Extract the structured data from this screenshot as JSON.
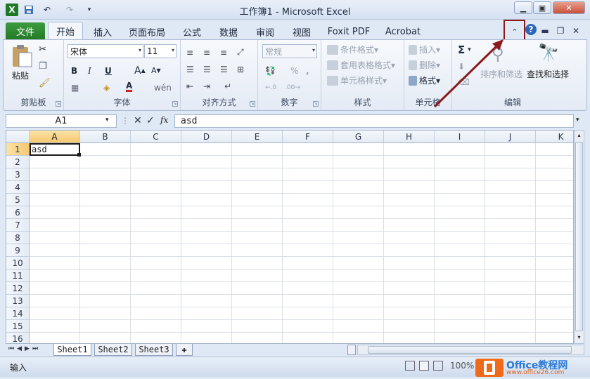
{
  "window": {
    "title": "工作簿1 - Microsoft Excel"
  },
  "qat": {
    "app_icon": "excel-logo-icon",
    "save_icon": "save-icon",
    "undo_icon": "undo-icon",
    "redo_icon": "redo-icon",
    "customize_icon": "customize-qat-icon"
  },
  "tabs": [
    {
      "label": "文件"
    },
    {
      "label": "开始"
    },
    {
      "label": "插入"
    },
    {
      "label": "页面布局"
    },
    {
      "label": "公式"
    },
    {
      "label": "数据"
    },
    {
      "label": "审阅"
    },
    {
      "label": "视图"
    },
    {
      "label": "Foxit PDF"
    },
    {
      "label": "Acrobat"
    }
  ],
  "ribbon": {
    "clipboard": {
      "paste": "粘贴",
      "label": "剪贴板"
    },
    "font": {
      "name": "宋体",
      "size": "11",
      "label": "字体",
      "bold": "B",
      "italic": "I",
      "underline": "U"
    },
    "alignment": {
      "label": "对齐方式"
    },
    "number": {
      "format": "常规",
      "percent": "%",
      "comma": ",",
      "label": "数字"
    },
    "styles": {
      "conditional": "条件格式",
      "table": "套用表格格式",
      "cell": "单元格样式",
      "label": "样式"
    },
    "cells": {
      "insert": "插入",
      "delete": "删除",
      "format": "格式",
      "label": "单元格"
    },
    "editing": {
      "sigma": "Σ",
      "sort": "排序和筛选",
      "find": "查找和选择",
      "label": "编辑"
    }
  },
  "formula_bar": {
    "name_box": "A1",
    "fx": "fx",
    "value": "asd"
  },
  "grid": {
    "columns": [
      "A",
      "B",
      "C",
      "D",
      "E",
      "F",
      "G",
      "H",
      "I",
      "J",
      "K"
    ],
    "rows": [
      "1",
      "2",
      "3",
      "4",
      "5",
      "6",
      "7",
      "8",
      "9",
      "10",
      "11",
      "12",
      "13",
      "14",
      "15",
      "16"
    ],
    "a1_value": "asd"
  },
  "sheets": [
    {
      "label": "Sheet1"
    },
    {
      "label": "Sheet2"
    },
    {
      "label": "Sheet3"
    }
  ],
  "status": {
    "mode": "输入",
    "zoom": "100%"
  },
  "watermark": {
    "brand": "Office教程网",
    "url": "www.office26.com"
  },
  "colors": {
    "file_tab": "#2f8a31",
    "callout": "#8b1a1a",
    "selection": "#f5c870"
  }
}
